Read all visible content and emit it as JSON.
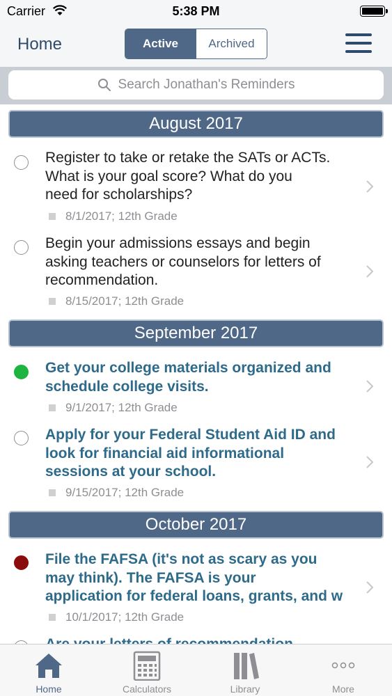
{
  "status": {
    "carrier": "Carrier",
    "time": "5:38 PM"
  },
  "nav": {
    "title": "Home",
    "segments": {
      "active": "Active",
      "archived": "Archived"
    }
  },
  "search": {
    "placeholder": "Search Jonathan's Reminders"
  },
  "sections": [
    {
      "title": "August 2017",
      "items": [
        {
          "lines": [
            "Register to take or retake the SATs or ACTs.",
            "What is your goal score?  What do you",
            "need for scholarships?"
          ],
          "meta": "8/1/2017;  12th Grade",
          "status": "empty"
        },
        {
          "lines": [
            "Begin your admissions essays and begin",
            "asking teachers or counselors for letters of",
            "recommendation."
          ],
          "meta": "8/15/2017;  12th Grade",
          "status": "empty"
        }
      ]
    },
    {
      "title": "September 2017",
      "items": [
        {
          "lines": [
            "Get your college materials organized and",
            "schedule college visits."
          ],
          "meta": "9/1/2017;  12th Grade",
          "status": "green"
        },
        {
          "lines": [
            "Apply for your Federal Student Aid ID and",
            "look for financial aid informational",
            "sessions at your school."
          ],
          "meta": "9/15/2017;  12th Grade",
          "status": "empty"
        }
      ]
    },
    {
      "title": "October 2017",
      "items": [
        {
          "lines": [
            "File the FAFSA (it's not as scary as you",
            "may think).  The FAFSA is your",
            "application for federal loans, grants, and w"
          ],
          "meta": "10/1/2017;  12th Grade",
          "status": "red"
        },
        {
          "lines": [
            "Are your letters of recommendation"
          ],
          "meta": "",
          "status": "empty"
        }
      ]
    }
  ],
  "tabs": {
    "home": "Home",
    "calculators": "Calculators",
    "library": "Library",
    "more": "More"
  },
  "colors": {
    "accent": "#4f6887",
    "nav_text": "#2f4a6a",
    "link_text": "#2e6a8a",
    "green": "#1db53f",
    "red": "#8b0c0c"
  }
}
